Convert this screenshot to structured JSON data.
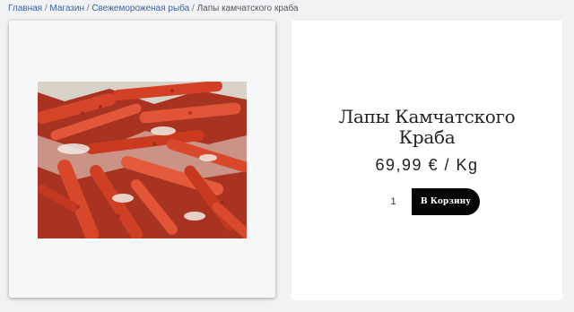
{
  "breadcrumb": {
    "items": [
      "Главная",
      "Магазин",
      "Свежемороженая рыба"
    ],
    "current": "Лапы камчатского краба",
    "separator": "/"
  },
  "product": {
    "title_line1": "Лапы Камчатского",
    "title_line2": "Краба",
    "price": "69,99 € / Kg",
    "quantity": "1",
    "add_to_cart_label": "В Корзину"
  },
  "colors": {
    "link": "#3e63a8",
    "button_bg": "#050505",
    "crab_red": "#c9361d"
  }
}
